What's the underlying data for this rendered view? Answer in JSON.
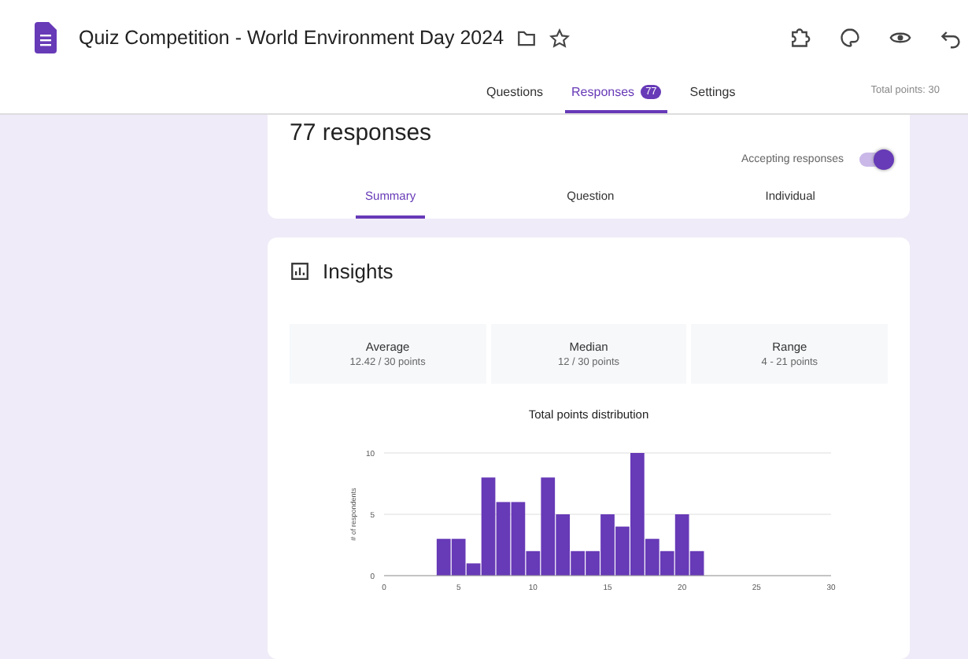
{
  "window": {
    "title": "Quiz Competition - World Environment Day 2024"
  },
  "tabs": [
    {
      "label": "Questions",
      "selected": false
    },
    {
      "label": "Responses",
      "selected": true,
      "badge": "77"
    },
    {
      "label": "Settings",
      "selected": false
    }
  ],
  "total_points": "Total points: 30",
  "responses_card": {
    "title": "77 responses",
    "accepting": {
      "label": "Accepting responses",
      "on": true
    },
    "views": [
      {
        "label": "Summary",
        "selected": true
      },
      {
        "label": "Question",
        "selected": false
      },
      {
        "label": "Individual",
        "selected": false
      }
    ]
  },
  "insights": {
    "title": "Insights",
    "stats": [
      {
        "label": "Average",
        "value": "12.42 / 30 points"
      },
      {
        "label": "Median",
        "value": "12 / 30 points"
      },
      {
        "label": "Range",
        "value": "4 - 21 points"
      }
    ],
    "chart_data": {
      "type": "bar",
      "title": "Total points distribution",
      "ylabel": "# of respondents",
      "x": [
        4,
        5,
        6,
        7,
        8,
        9,
        10,
        11,
        12,
        13,
        14,
        15,
        16,
        17,
        18,
        19,
        20,
        21
      ],
      "series": [
        {
          "color": "#673ab7",
          "values": [
            3,
            3,
            1,
            8,
            6,
            6,
            2,
            8,
            5,
            2,
            2,
            5,
            4,
            10,
            3,
            2,
            5,
            2
          ]
        }
      ],
      "xlim": [
        0,
        30
      ],
      "ylim": [
        0,
        10
      ],
      "xticks": [
        0,
        5,
        10,
        15,
        20,
        25,
        30
      ],
      "yticks": [
        0,
        5,
        10
      ]
    }
  }
}
